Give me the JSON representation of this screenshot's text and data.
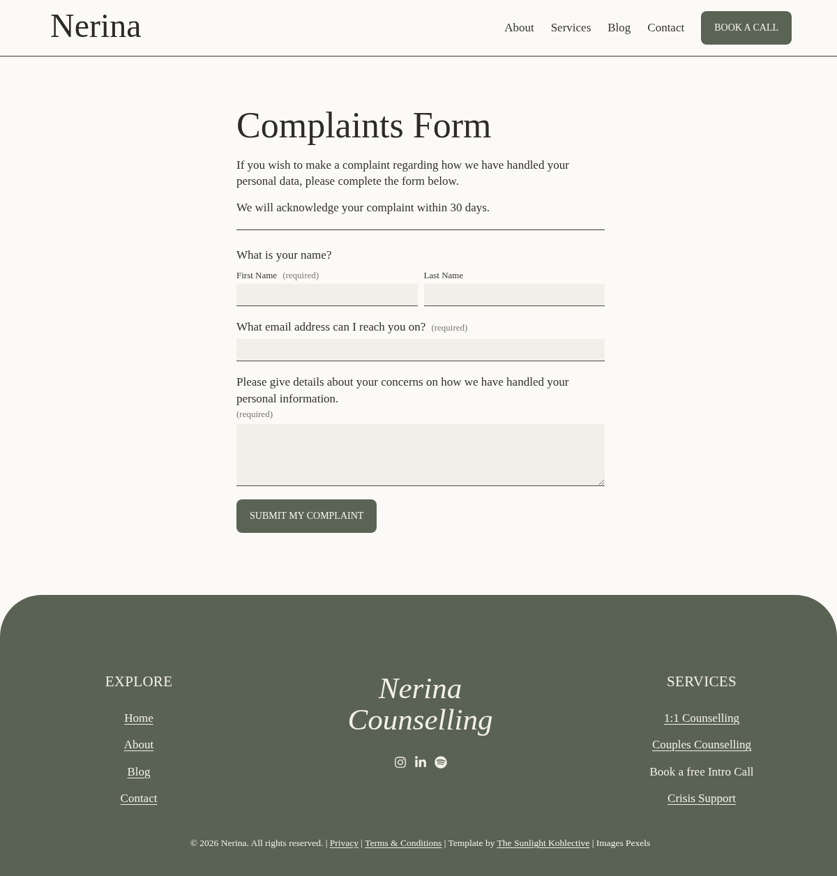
{
  "header": {
    "logo": "Nerina",
    "nav": [
      "About",
      "Services",
      "Blog",
      "Contact"
    ],
    "cta": "BOOK A CALL"
  },
  "intro": {
    "title": "Complaints Form",
    "paragraphs": [
      "If you wish to make a complaint regarding how we have handled your personal data, please complete the form below.",
      "We will acknowledge your complaint within 30 days."
    ]
  },
  "form": {
    "sections": [
      {
        "kind": "split",
        "question": "What is your name?",
        "fields": [
          {
            "label": "First Name",
            "note": "(required)"
          },
          {
            "label": "Last Name"
          }
        ]
      },
      {
        "kind": "input",
        "question": "What email address can I reach you on?",
        "note": "(required)"
      },
      {
        "kind": "textarea",
        "question": "Please give details about your concerns on how we have handled your personal information.",
        "note": "(required)"
      }
    ],
    "submit": "SUBMIT MY COMPLAINT"
  },
  "footer": {
    "explore": {
      "heading": "EXPLORE",
      "items": [
        {
          "text": "Home",
          "link": true
        },
        {
          "text": "About",
          "link": true
        },
        {
          "text": "Blog",
          "link": true
        },
        {
          "text": "Contact",
          "link": true
        }
      ]
    },
    "brand": "Nerina Counselling",
    "services": {
      "heading": "SERVICES",
      "items": [
        {
          "text": "1:1 Counselling",
          "link": true
        },
        {
          "text": "Couples Counselling",
          "link": true
        },
        {
          "text": "Book a free Intro Call",
          "link": false
        },
        {
          "text": "Crisis Support",
          "link": true
        }
      ]
    },
    "legal": [
      {
        "text": "© 2026 Nerina. All rights reserved. | ",
        "link": false
      },
      {
        "text": "Privacy",
        "link": true
      },
      {
        "text": " | ",
        "link": false
      },
      {
        "text": "Terms & Conditions",
        "link": true
      },
      {
        "text": " | Template by ",
        "link": false
      },
      {
        "text": "The Sunlight Kohlective",
        "link": true
      },
      {
        "text": " | Images Pexels",
        "link": false
      }
    ]
  }
}
